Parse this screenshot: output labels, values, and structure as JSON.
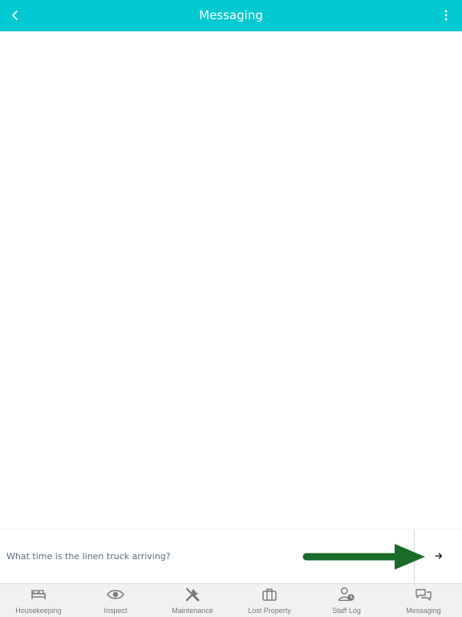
{
  "header": {
    "title": "Messaging",
    "back_icon": "chevron-left-icon",
    "menu_icon": "more-vertical-icon",
    "background": "#00c9d1"
  },
  "composer": {
    "value": "What time is the linen truck arriving?",
    "send_icon": "arrow-right-icon"
  },
  "annotation": {
    "arrow_color": "#1a6b2a"
  },
  "bottom_nav": {
    "items": [
      {
        "label": "Housekeeping",
        "icon": "bed-icon"
      },
      {
        "label": "Inspect",
        "icon": "eye-icon"
      },
      {
        "label": "Maintenance",
        "icon": "tools-icon"
      },
      {
        "label": "Lost Property",
        "icon": "briefcase-icon"
      },
      {
        "label": "Staff Log",
        "icon": "user-clock-icon"
      },
      {
        "label": "Messaging",
        "icon": "chat-bubbles-icon"
      }
    ]
  }
}
